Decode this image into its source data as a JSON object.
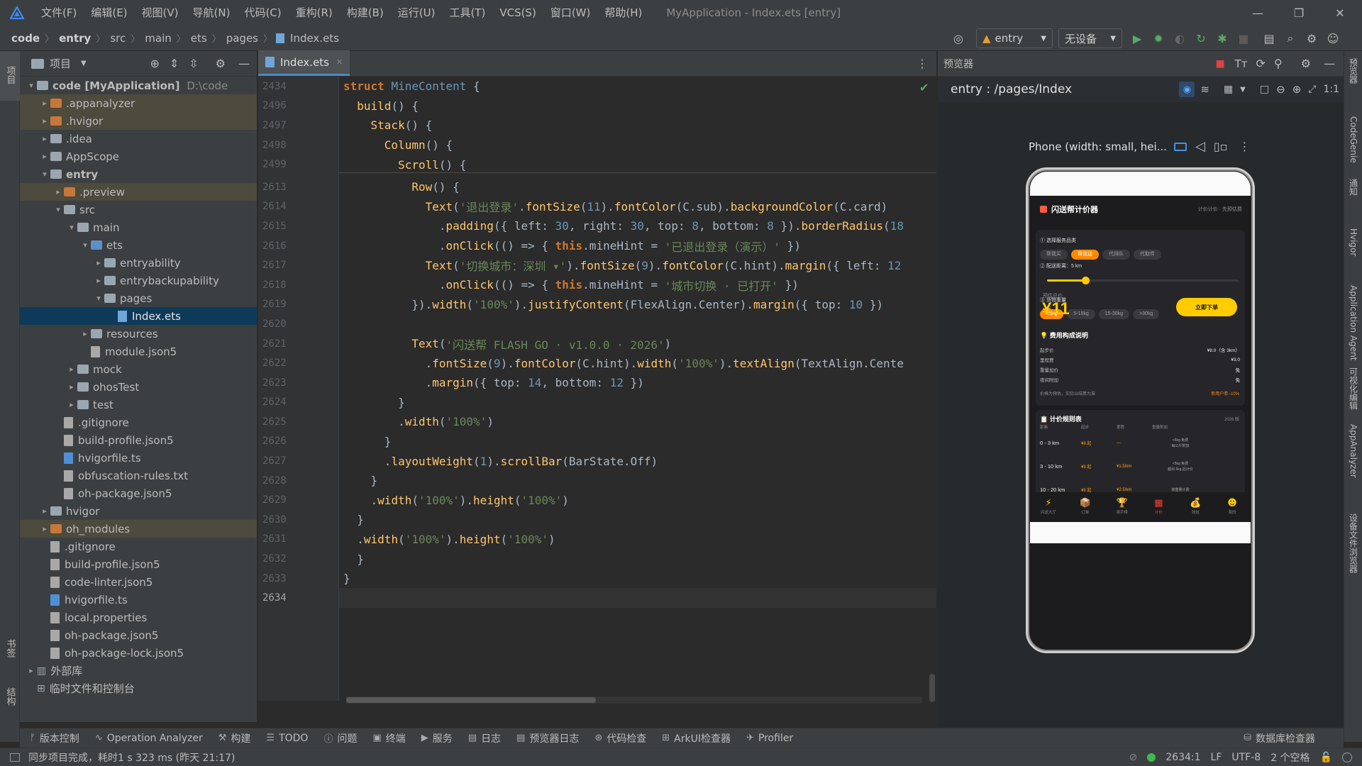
{
  "menu": {
    "items": [
      "文件(F)",
      "编辑(E)",
      "视图(V)",
      "导航(N)",
      "代码(C)",
      "重构(R)",
      "构建(B)",
      "运行(U)",
      "工具(T)",
      "VCS(S)",
      "窗口(W)",
      "帮助(H)"
    ],
    "window_title": "MyApplication - Index.ets [entry]"
  },
  "breadcrumb": [
    "code",
    "entry",
    "src",
    "main",
    "ets",
    "pages",
    "Index.ets"
  ],
  "toolbar": {
    "module": "entry",
    "device": "无设备"
  },
  "left_stripe": {
    "project": "项目",
    "bookmarks": "书签",
    "structure": "结构"
  },
  "project_panel": {
    "title": "项目"
  },
  "tree": [
    {
      "label": "code [MyApplication]",
      "extra": "D:\\code",
      "depth": 0,
      "arrow": "▾",
      "icon": "folder",
      "bold": true
    },
    {
      "label": ".appanalyzer",
      "depth": 1,
      "arrow": "▸",
      "icon": "folder-orange",
      "hl": true
    },
    {
      "label": ".hvigor",
      "depth": 1,
      "arrow": "▸",
      "icon": "folder-orange",
      "hl": true
    },
    {
      "label": ".idea",
      "depth": 1,
      "arrow": "▸",
      "icon": "folder"
    },
    {
      "label": "AppScope",
      "depth": 1,
      "arrow": "▸",
      "icon": "folder"
    },
    {
      "label": "entry",
      "depth": 1,
      "arrow": "▾",
      "icon": "folder",
      "bold": true
    },
    {
      "label": ".preview",
      "depth": 2,
      "arrow": "▸",
      "icon": "folder-orange",
      "hl": true
    },
    {
      "label": "src",
      "depth": 2,
      "arrow": "▾",
      "icon": "folder"
    },
    {
      "label": "main",
      "depth": 3,
      "arrow": "▾",
      "icon": "folder"
    },
    {
      "label": "ets",
      "depth": 4,
      "arrow": "▾",
      "icon": "folder-blue"
    },
    {
      "label": "entryability",
      "depth": 5,
      "arrow": "▸",
      "icon": "folder"
    },
    {
      "label": "entrybackupability",
      "depth": 5,
      "arrow": "▸",
      "icon": "folder"
    },
    {
      "label": "pages",
      "depth": 5,
      "arrow": "▾",
      "icon": "folder"
    },
    {
      "label": "Index.ets",
      "depth": 6,
      "arrow": "",
      "icon": "file-ets",
      "sel": true
    },
    {
      "label": "resources",
      "depth": 4,
      "arrow": "▸",
      "icon": "folder"
    },
    {
      "label": "module.json5",
      "depth": 4,
      "arrow": "",
      "icon": "file"
    },
    {
      "label": "mock",
      "depth": 3,
      "arrow": "▸",
      "icon": "folder"
    },
    {
      "label": "ohosTest",
      "depth": 3,
      "arrow": "▸",
      "icon": "folder"
    },
    {
      "label": "test",
      "depth": 3,
      "arrow": "▸",
      "icon": "folder"
    },
    {
      "label": ".gitignore",
      "depth": 2,
      "arrow": "",
      "icon": "file"
    },
    {
      "label": "build-profile.json5",
      "depth": 2,
      "arrow": "",
      "icon": "file"
    },
    {
      "label": "hvigorfile.ts",
      "depth": 2,
      "arrow": "",
      "icon": "file-ts"
    },
    {
      "label": "obfuscation-rules.txt",
      "depth": 2,
      "arrow": "",
      "icon": "file"
    },
    {
      "label": "oh-package.json5",
      "depth": 2,
      "arrow": "",
      "icon": "file"
    },
    {
      "label": "hvigor",
      "depth": 1,
      "arrow": "▸",
      "icon": "folder"
    },
    {
      "label": "oh_modules",
      "depth": 1,
      "arrow": "▸",
      "icon": "folder-orange",
      "hl": true
    },
    {
      "label": ".gitignore",
      "depth": 1,
      "arrow": "",
      "icon": "file"
    },
    {
      "label": "build-profile.json5",
      "depth": 1,
      "arrow": "",
      "icon": "file"
    },
    {
      "label": "code-linter.json5",
      "depth": 1,
      "arrow": "",
      "icon": "file"
    },
    {
      "label": "hvigorfile.ts",
      "depth": 1,
      "arrow": "",
      "icon": "file-ts"
    },
    {
      "label": "local.properties",
      "depth": 1,
      "arrow": "",
      "icon": "file"
    },
    {
      "label": "oh-package.json5",
      "depth": 1,
      "arrow": "",
      "icon": "file"
    },
    {
      "label": "oh-package-lock.json5",
      "depth": 1,
      "arrow": "",
      "icon": "file"
    },
    {
      "label": "外部库",
      "depth": 0,
      "arrow": "▸",
      "icon": "lib"
    },
    {
      "label": "临时文件和控制台",
      "depth": 0,
      "arrow": "",
      "icon": "console"
    }
  ],
  "editor": {
    "tab": "Index.ets",
    "line_numbers": [
      "2434",
      "2496",
      "2497",
      "2498",
      "2499",
      "2613",
      "2614",
      "2615",
      "2616",
      "2617",
      "2618",
      "2619",
      "2620",
      "2621",
      "2622",
      "2623",
      "2624",
      "2625",
      "2626",
      "2627",
      "2628",
      "2629",
      "2630",
      "2631",
      "2632",
      "2633",
      "2634"
    ],
    "lines": [
      [
        [
          "kw",
          "struct "
        ],
        [
          "cls",
          "MineContent "
        ],
        [
          "pl",
          "{"
        ]
      ],
      [
        [
          "pl",
          "  "
        ],
        [
          "fn",
          "build"
        ],
        [
          "pl",
          "() {"
        ]
      ],
      [
        [
          "pl",
          "    "
        ],
        [
          "fn",
          "Stack"
        ],
        [
          "pl",
          "() {"
        ]
      ],
      [
        [
          "pl",
          "      "
        ],
        [
          "fn",
          "Column"
        ],
        [
          "pl",
          "() {"
        ]
      ],
      [
        [
          "pl",
          "        "
        ],
        [
          "fn",
          "Scroll"
        ],
        [
          "pl",
          "() {"
        ]
      ],
      [
        [
          "pl",
          "          "
        ],
        [
          "fn",
          "Row"
        ],
        [
          "pl",
          "() {"
        ]
      ],
      [
        [
          "pl",
          "            "
        ],
        [
          "fn",
          "Text"
        ],
        [
          "pl",
          "("
        ],
        [
          "st",
          "'退出登录'"
        ],
        [
          "pl",
          "."
        ],
        [
          "fn",
          "fontSize"
        ],
        [
          "pl",
          "("
        ],
        [
          "nu",
          "11"
        ],
        [
          "pl",
          ")."
        ],
        [
          "fn",
          "fontColor"
        ],
        [
          "pl",
          "(C.sub)."
        ],
        [
          "fn",
          "backgroundColor"
        ],
        [
          "pl",
          "(C.card)"
        ]
      ],
      [
        [
          "pl",
          "              ."
        ],
        [
          "fn",
          "padding"
        ],
        [
          "pl",
          "({ left: "
        ],
        [
          "nu",
          "30"
        ],
        [
          "pl",
          ", right: "
        ],
        [
          "nu",
          "30"
        ],
        [
          "pl",
          ", top: "
        ],
        [
          "nu",
          "8"
        ],
        [
          "pl",
          ", bottom: "
        ],
        [
          "nu",
          "8"
        ],
        [
          "pl",
          " })."
        ],
        [
          "fn",
          "borderRadius"
        ],
        [
          "pl",
          "("
        ],
        [
          "nu",
          "18"
        ]
      ],
      [
        [
          "pl",
          "              ."
        ],
        [
          "fn",
          "onClick"
        ],
        [
          "pl",
          "(() => { "
        ],
        [
          "kw",
          "this"
        ],
        [
          "pl",
          ".mineHint = "
        ],
        [
          "st",
          "'已退出登录（演示）'"
        ],
        [
          "pl",
          " })"
        ]
      ],
      [
        [
          "pl",
          "            "
        ],
        [
          "fn",
          "Text"
        ],
        [
          "pl",
          "("
        ],
        [
          "st",
          "'切换城市：深圳 ▾'"
        ],
        [
          "pl",
          ")."
        ],
        [
          "fn",
          "fontSize"
        ],
        [
          "pl",
          "("
        ],
        [
          "nu",
          "9"
        ],
        [
          "pl",
          ")."
        ],
        [
          "fn",
          "fontColor"
        ],
        [
          "pl",
          "(C.hint)."
        ],
        [
          "fn",
          "margin"
        ],
        [
          "pl",
          "({ left: "
        ],
        [
          "nu",
          "12"
        ]
      ],
      [
        [
          "pl",
          "              ."
        ],
        [
          "fn",
          "onClick"
        ],
        [
          "pl",
          "(() => { "
        ],
        [
          "kw",
          "this"
        ],
        [
          "pl",
          ".mineHint = "
        ],
        [
          "st",
          "'城市切换 · 已打开'"
        ],
        [
          "pl",
          " })"
        ]
      ],
      [
        [
          "pl",
          "          })."
        ],
        [
          "fn",
          "width"
        ],
        [
          "pl",
          "("
        ],
        [
          "st",
          "'100%'"
        ],
        [
          "pl",
          ")."
        ],
        [
          "fn",
          "justifyContent"
        ],
        [
          "pl",
          "(FlexAlign.Center)."
        ],
        [
          "fn",
          "margin"
        ],
        [
          "pl",
          "({ top: "
        ],
        [
          "nu",
          "10"
        ],
        [
          "pl",
          " })"
        ]
      ],
      [
        [
          "pl",
          ""
        ]
      ],
      [
        [
          "pl",
          "          "
        ],
        [
          "fn",
          "Text"
        ],
        [
          "pl",
          "("
        ],
        [
          "st",
          "'闪送帮 FLASH GO · v1.0.0 · 2026'"
        ],
        [
          "pl",
          ")"
        ]
      ],
      [
        [
          "pl",
          "            ."
        ],
        [
          "fn",
          "fontSize"
        ],
        [
          "pl",
          "("
        ],
        [
          "nu",
          "9"
        ],
        [
          "pl",
          ")."
        ],
        [
          "fn",
          "fontColor"
        ],
        [
          "pl",
          "(C.hint)."
        ],
        [
          "fn",
          "width"
        ],
        [
          "pl",
          "("
        ],
        [
          "st",
          "'100%'"
        ],
        [
          "pl",
          ")."
        ],
        [
          "fn",
          "textAlign"
        ],
        [
          "pl",
          "(TextAlign.Cente"
        ]
      ],
      [
        [
          "pl",
          "            ."
        ],
        [
          "fn",
          "margin"
        ],
        [
          "pl",
          "({ top: "
        ],
        [
          "nu",
          "14"
        ],
        [
          "pl",
          ", bottom: "
        ],
        [
          "nu",
          "12"
        ],
        [
          "pl",
          " })"
        ]
      ],
      [
        [
          "pl",
          "        }"
        ]
      ],
      [
        [
          "pl",
          "        ."
        ],
        [
          "fn",
          "width"
        ],
        [
          "pl",
          "("
        ],
        [
          "st",
          "'100%'"
        ],
        [
          "pl",
          ")"
        ]
      ],
      [
        [
          "pl",
          "      }"
        ]
      ],
      [
        [
          "pl",
          "      ."
        ],
        [
          "fn",
          "layoutWeight"
        ],
        [
          "pl",
          "("
        ],
        [
          "nu",
          "1"
        ],
        [
          "pl",
          ")."
        ],
        [
          "fn",
          "scrollBar"
        ],
        [
          "pl",
          "(BarState.Off)"
        ]
      ],
      [
        [
          "pl",
          "    }"
        ]
      ],
      [
        [
          "pl",
          "    ."
        ],
        [
          "fn",
          "width"
        ],
        [
          "pl",
          "("
        ],
        [
          "st",
          "'100%'"
        ],
        [
          "pl",
          ")."
        ],
        [
          "fn",
          "height"
        ],
        [
          "pl",
          "("
        ],
        [
          "st",
          "'100%'"
        ],
        [
          "pl",
          ")"
        ]
      ],
      [
        [
          "pl",
          "  }"
        ]
      ],
      [
        [
          "pl",
          "  ."
        ],
        [
          "fn",
          "width"
        ],
        [
          "pl",
          "("
        ],
        [
          "st",
          "'100%'"
        ],
        [
          "pl",
          ")."
        ],
        [
          "fn",
          "height"
        ],
        [
          "pl",
          "("
        ],
        [
          "st",
          "'100%'"
        ],
        [
          "pl",
          ")"
        ]
      ],
      [
        [
          "pl",
          "  }"
        ]
      ],
      [
        [
          "pl",
          "}"
        ]
      ],
      [
        [
          "pl",
          ""
        ]
      ]
    ]
  },
  "previewer": {
    "title": "预览器",
    "route": "entry : /pages/Index",
    "device_label": "Phone (width: small, hei..."
  },
  "app": {
    "title": "闪送帮计价器",
    "header_right": "计价计价 · 先预估费",
    "service_label": "① 选择服务品类",
    "services": [
      "帮我买",
      "帮我送",
      "代排队",
      "代取件"
    ],
    "service_selected": 1,
    "distance_label": "② 配送距离：5 km",
    "distance_fraction": 0.2,
    "weight_label": "③ 货物重量",
    "weights": [
      "<5kg",
      "5-15kg",
      "15-30kg",
      ">30kg"
    ],
    "weight_selected": 0,
    "estimate_label": "预估总价",
    "price": "¥11",
    "order_button": "立即下单",
    "fee_title": "费用构成说明",
    "fees": [
      {
        "k": "起步价",
        "v": "¥8.0（含 3km）"
      },
      {
        "k": "里程费",
        "v": "¥3.0"
      },
      {
        "k": "重量加价",
        "v": "免"
      },
      {
        "k": "夜间附加",
        "v": "免"
      }
    ],
    "fee_note_left": "价格为预估，实际以结算为准",
    "fee_note_right": "新用户券 -10%",
    "rules_title": "计价规则表",
    "rules_right": "2026 版",
    "rules_headers": [
      "距离",
      "起步",
      "里程",
      "重量附加"
    ],
    "rules": [
      {
        "d": "0 - 3 km",
        "a": "¥8 起",
        "b": "—",
        "c": "<5kg 免费\n每公斤附加"
      },
      {
        "d": "3 - 10 km",
        "a": "¥8 起",
        "b": "¥1.5/km",
        "c": "<5kg 免费\n超出 5kg 后计价"
      },
      {
        "d": "10 - 20 km",
        "a": "¥8 起",
        "b": "¥2.5/km",
        "c": "按重量计费"
      }
    ],
    "tabs": [
      "闪送大厅",
      "订单",
      "骑手榜",
      "计价",
      "钱包",
      "我的"
    ],
    "tab_icons": [
      "⚡",
      "📦",
      "🏆",
      "▦",
      "💰",
      "☻"
    ],
    "tab_selected": 3
  },
  "right_stripe": [
    "预览器",
    "CodeGenie",
    "通知",
    "Hvigor",
    "Application Agent",
    "可视化编辑",
    "AppAnalyzer",
    "设备文件浏览器"
  ],
  "bottom_tools": [
    "版本控制",
    "Operation Analyzer",
    "构建",
    "TODO",
    "问题",
    "终端",
    "服务",
    "日志",
    "预览器日志",
    "代码检查",
    "ArkUI检查器",
    "Profiler"
  ],
  "bottom_tool_icons": [
    "ᚠ",
    "∿",
    "⚒",
    "☰",
    "ⓘ",
    "▣",
    "▶",
    "▤",
    "▤",
    "⊛",
    "⊞",
    "✈"
  ],
  "db_inspector": "数据库检查器",
  "status": {
    "message": "同步项目完成，耗时1 s 323 ms (昨天 21:17)",
    "position": "2634:1",
    "line_sep": "LF",
    "encoding": "UTF-8",
    "indent": "2 个空格"
  }
}
